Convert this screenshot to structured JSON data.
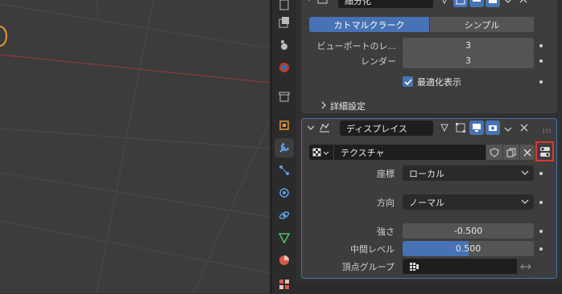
{
  "subdivision": {
    "name": "細分化",
    "mode_tabs": [
      "カトマルクラーク",
      "シンプル"
    ],
    "viewport_label": "ビューポートのレ...",
    "viewport_value": "3",
    "render_label": "レンダー",
    "render_value": "3",
    "optimal_display_label": "最適化表示",
    "advanced_label": "詳細設定"
  },
  "displace": {
    "name": "ディスプレイス",
    "texture_name": "テクスチャ",
    "coords_label": "座標",
    "coords_value": "ローカル",
    "direction_label": "方向",
    "direction_value": "ノーマル",
    "strength_label": "強さ",
    "strength_value": "-0.500",
    "midlevel_label": "中間レベル",
    "midlevel_value": "0.500",
    "midlevel_fraction": 0.5,
    "vertex_group_label": "頂点グループ",
    "vertex_group_value": ""
  },
  "colors": {
    "accent": "#4772b3",
    "highlight": "#e0382f",
    "object_origin": "#e59735"
  },
  "tabs": [
    "tool-icon",
    "render-icon",
    "output-icon",
    "view-layer-icon",
    "scene-icon",
    "world-icon",
    "collection-icon",
    "object-icon",
    "modifier-icon",
    "particles-icon",
    "physics-icon",
    "constraints-icon",
    "data-icon",
    "material-icon",
    "texture-icon"
  ]
}
